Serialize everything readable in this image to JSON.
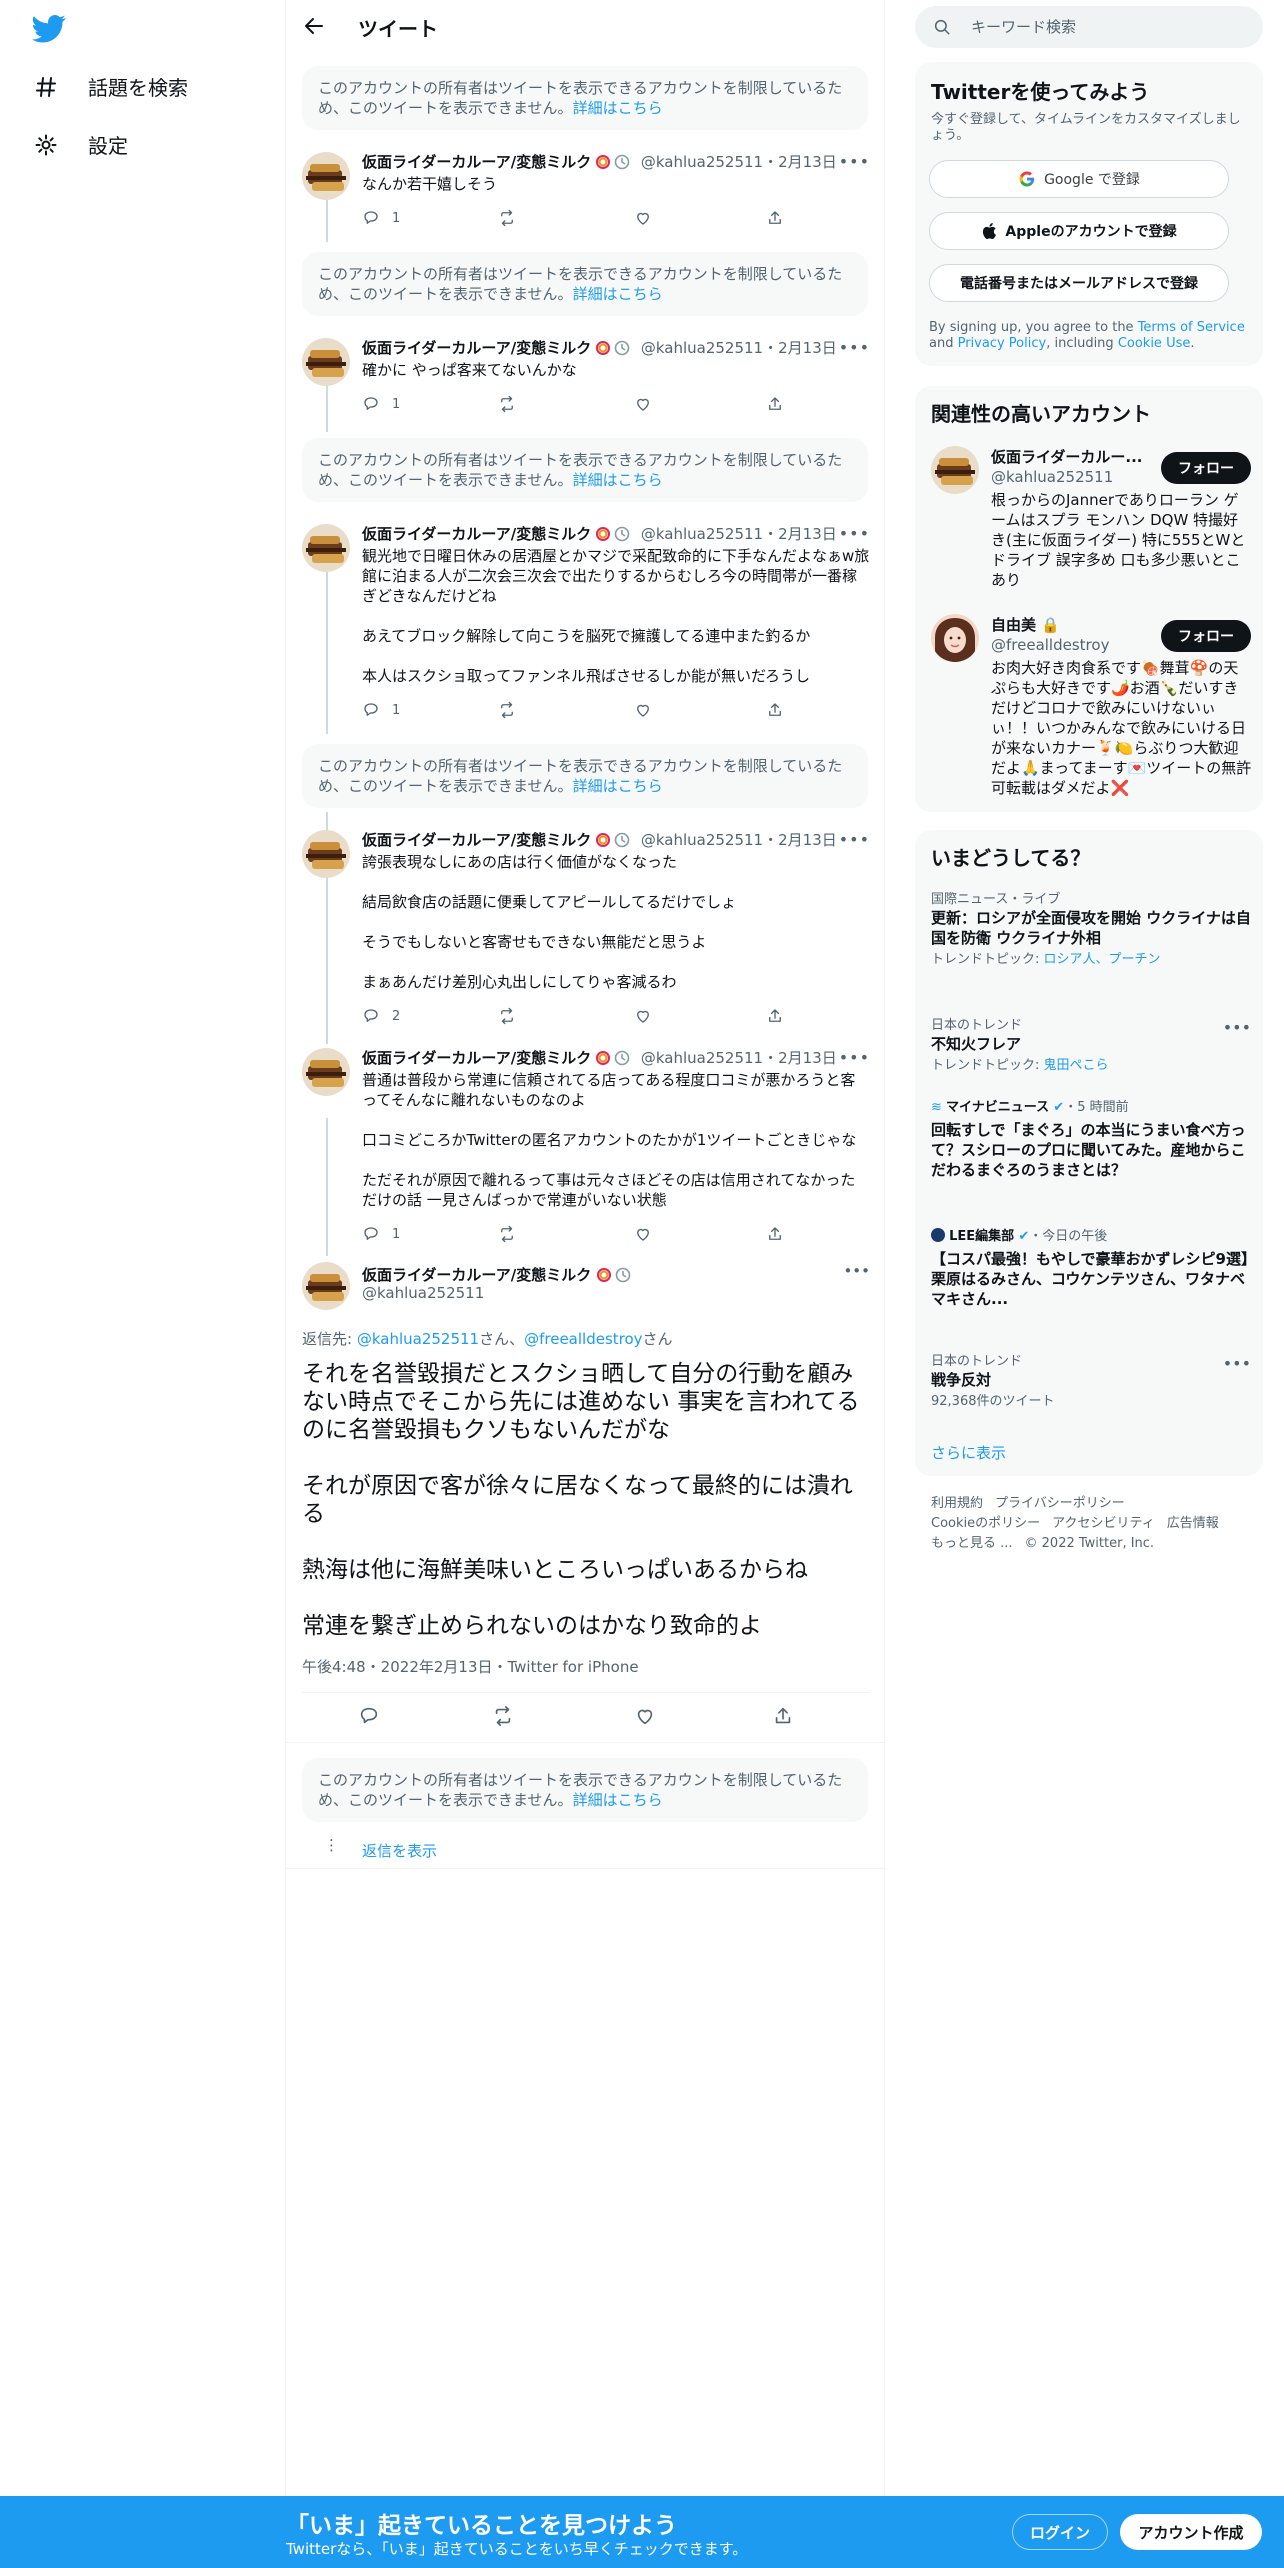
{
  "nav": {
    "items": [
      {
        "label": "話題を検索",
        "icon": "hashtag-icon"
      },
      {
        "label": "設定",
        "icon": "gear-icon"
      }
    ]
  },
  "header": {
    "title": "ツイート"
  },
  "restricted": {
    "text": "このアカウントの所有者はツイートを表示できるアカウントを制限しているため、このツイートを表示できません。",
    "link": "詳細はこちら"
  },
  "author": {
    "name": "仮面ライダーカルーア/変態ミルク",
    "handle": "@kahlua252511",
    "date": "2月13日"
  },
  "thread": [
    {
      "text": "なんか若干嬉しそう",
      "replies": "1"
    },
    {
      "text": "確かに やっぱ客来てないんかな",
      "replies": "1"
    },
    {
      "text": "観光地で日曜日休みの居酒屋とかマジで采配致命的に下手なんだよなぁw旅館に泊まる人が二次会三次会で出たりするからむしろ今の時間帯が一番稼ぎどきなんだけどね\n\nあえてブロック解除して向こうを脳死で擁護してる連中また釣るか\n\n本人はスクショ取ってファンネル飛ばさせるしか能が無いだろうし",
      "replies": "1"
    },
    {
      "text": "誇張表現なしにあの店は行く価値がなくなった\n\n結局飲食店の話題に便乗してアピールしてるだけでしょ\n\nそうでもしないと客寄せもできない無能だと思うよ\n\nまぁあんだけ差別心丸出しにしてりゃ客減るわ",
      "replies": "2"
    },
    {
      "text": "普通は普段から常連に信頼されてる店ってある程度口コミが悪かろうと客ってそんなに離れないものなのよ\n\n口コミどころかTwitterの匿名アカウントのたかが1ツイートごときじゃな\n\nただそれが原因で離れるって事は元々さほどその店は信用されてなかっただけの話 一見さんばっかで常連がいない状態",
      "replies": "1"
    }
  ],
  "main_tweet": {
    "reply_prefix": "返信先: ",
    "reply_to_1": "@kahlua252511",
    "reply_mid": "さん、",
    "reply_to_2": "@freealldestroy",
    "reply_suffix": "さん",
    "text": "それを名誉毀損だとスクショ晒して自分の行動を顧みない時点でそこから先には進めない 事実を言われてるのに名誉毀損もクソもないんだがな\n\nそれが原因で客が徐々に居なくなって最終的には潰れる\n\n熱海は他に海鮮美味いところいっぱいあるからね\n\n常連を繋ぎ止められないのはかなり致命的よ",
    "meta": "午後4:48・2022年2月13日・Twitter for iPhone"
  },
  "show_replies": "返信を表示",
  "search": {
    "placeholder": "キーワード検索"
  },
  "signup": {
    "title": "Twitterを使ってみよう",
    "subtitle": "今すぐ登録して、タイムラインをカスタマイズしましょう。",
    "google": "Google で登録",
    "apple": "Appleのアカウントで登録",
    "phone": "電話番号またはメールアドレスで登録",
    "terms_pre": "By signing up, you agree to the ",
    "terms_link": "Terms of Service",
    "terms_and": " and ",
    "privacy_link": "Privacy Policy",
    "terms_incl": ", including ",
    "cookie_link": "Cookie Use",
    "terms_end": "."
  },
  "relevant": {
    "title": "関連性の高いアカウント",
    "follow_label": "フォロー",
    "accounts": [
      {
        "name": "仮面ライダーカルー...",
        "handle": "@kahlua252511",
        "bio": "根っからのJannerでありローラン ゲームはスプラ モンハン DQW 特撮好き(主に仮面ライダー) 特に555とWとドライブ 誤字多め 口も多少悪いとこあり"
      },
      {
        "name": "自由美",
        "handle": "@freealldestroy",
        "bio": "お肉大好き肉食系です🍖舞茸🍄の天ぷらも大好きです🌶️お酒🍾だいすきだけどコロナで飲みにいけないぃぃ！！いつかみんなで飲みにいける日が来ないカナー🍹🍋らぶりつ大歓迎だよ🙏まってまーす💌ツイートの無許可転載はダメだよ❌"
      }
    ]
  },
  "trends": {
    "title": "いまどうしてる？",
    "items": [
      {
        "context": "国際ニュース・ライブ",
        "title": "更新：ロシアが全面侵攻を開始 ウクライナは自国を防衛 ウクライナ外相",
        "sub_prefix": "トレンドトピック: ",
        "sub_links": "ロシア人、プーチン"
      },
      {
        "context": "日本のトレンド",
        "title": "不知火フレア",
        "sub_prefix": "トレンドトピック: ",
        "sub_links": "鬼田ぺこら"
      },
      {
        "context": "マイナビニュース",
        "context_time": "・5 時間前",
        "title": "回転すしで「まぐろ」の本当にうまい食べ方って？スシローのプロに聞いてみた。産地からこだわるまぐろのうまさとは？"
      },
      {
        "context": "LEE編集部",
        "context_time": "・今日の午後",
        "title": "【コスパ最強！もやしで豪華おかずレシピ9選】栗原はるみさん、コウケンテツさん、ワタナベマキさん..."
      },
      {
        "context": "日本のトレンド",
        "title": "戦争反対",
        "sub_prefix": "92,368件のツイート"
      }
    ],
    "show_more": "さらに表示"
  },
  "footer": {
    "links": [
      "利用規約",
      "プライバシーポリシー",
      "Cookieのポリシー",
      "アクセシビリティ",
      "広告情報",
      "もっと見る ..."
    ],
    "copyright": "© 2022 Twitter, Inc."
  },
  "banner": {
    "title": "「いま」起きていることを見つけよう",
    "subtitle": "Twitterなら、「いま」起きていることをいち早くチェックできます。",
    "login": "ログイン",
    "signup": "アカウント作成"
  },
  "colors": {
    "accent": "#1d9bf0",
    "text": "#0f1419",
    "muted": "#536471"
  }
}
